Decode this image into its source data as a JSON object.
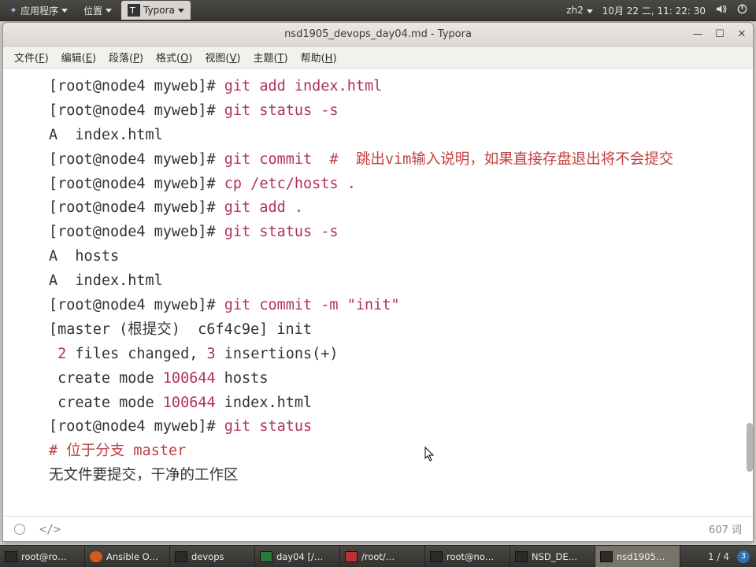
{
  "top_panel": {
    "apps": "应用程序",
    "places": "位置",
    "active_app": "Typora",
    "im": "zh2",
    "date": "10月 22 二,  11: 22: 30",
    "triangle": "▾"
  },
  "window": {
    "title": "nsd1905_devops_day04.md - Typora"
  },
  "menubar": {
    "file": "文件(",
    "file_u": "F",
    "file_e": ")",
    "edit": "编辑(",
    "edit_u": "E",
    "edit_e": ")",
    "para": "段落(",
    "para_u": "P",
    "para_e": ")",
    "fmt": "格式(",
    "fmt_u": "O",
    "fmt_e": ")",
    "view": "视图(",
    "view_u": "V",
    "view_e": ")",
    "theme": "主题(",
    "theme_u": "T",
    "theme_e": ")",
    "help": "帮助(",
    "help_u": "H",
    "help_e": ")"
  },
  "lines": [
    {
      "prompt": "[root@node4 myweb]# ",
      "cmd": "git add index.html"
    },
    {
      "prompt": "[root@node4 myweb]# ",
      "cmd": "git status -s"
    },
    {
      "plain": "A  index.html"
    },
    {
      "prompt": "[root@node4 myweb]# ",
      "cmd": "git commit  ",
      "comment": "#  跳出vim输入说明，如果直接存盘退出将不会提交"
    },
    {
      "prompt": "[root@node4 myweb]# ",
      "cmd": "cp /etc/hosts ."
    },
    {
      "prompt": "[root@node4 myweb]# ",
      "cmd": "git add ."
    },
    {
      "prompt": "[root@node4 myweb]# ",
      "cmd": "git status -s"
    },
    {
      "plain": "A  hosts"
    },
    {
      "plain": "A  index.html"
    },
    {
      "prompt": "[root@node4 myweb]# ",
      "cmd": "git commit -m \"init\""
    },
    {
      "plain_pre": "[master (根提交)  c6f4c9e] init"
    },
    {
      "plain_pre": " ",
      "num1": "2",
      "mid1": " files changed, ",
      "num2": "3",
      "mid2": " insertions(+)"
    },
    {
      "plain_pre": " create mode ",
      "num1": "100644",
      "mid1": " hosts"
    },
    {
      "plain_pre": " create mode ",
      "num1": "100644",
      "mid1": " index.html"
    },
    {
      "prompt": "[root@node4 myweb]# ",
      "cmd": "git status"
    },
    {
      "comment": "# 位于分支 master"
    },
    {
      "plain": "无文件要提交，干净的工作区"
    }
  ],
  "statusbar": {
    "code": "</>",
    "words": "607 词"
  },
  "taskbar": {
    "items": [
      {
        "label": "root@ro…",
        "ico": "term"
      },
      {
        "label": "Ansible O…",
        "ico": "ff"
      },
      {
        "label": "devops",
        "ico": "term"
      },
      {
        "label": "day04 [/…",
        "ico": "pc"
      },
      {
        "label": "/root/…",
        "ico": "ld"
      },
      {
        "label": "root@no…",
        "ico": "term"
      },
      {
        "label": "NSD_DE…",
        "ico": "term"
      },
      {
        "label": "nsd1905…",
        "ico": "term",
        "active": true
      }
    ],
    "pager": "1 / 4",
    "noti": "3"
  }
}
